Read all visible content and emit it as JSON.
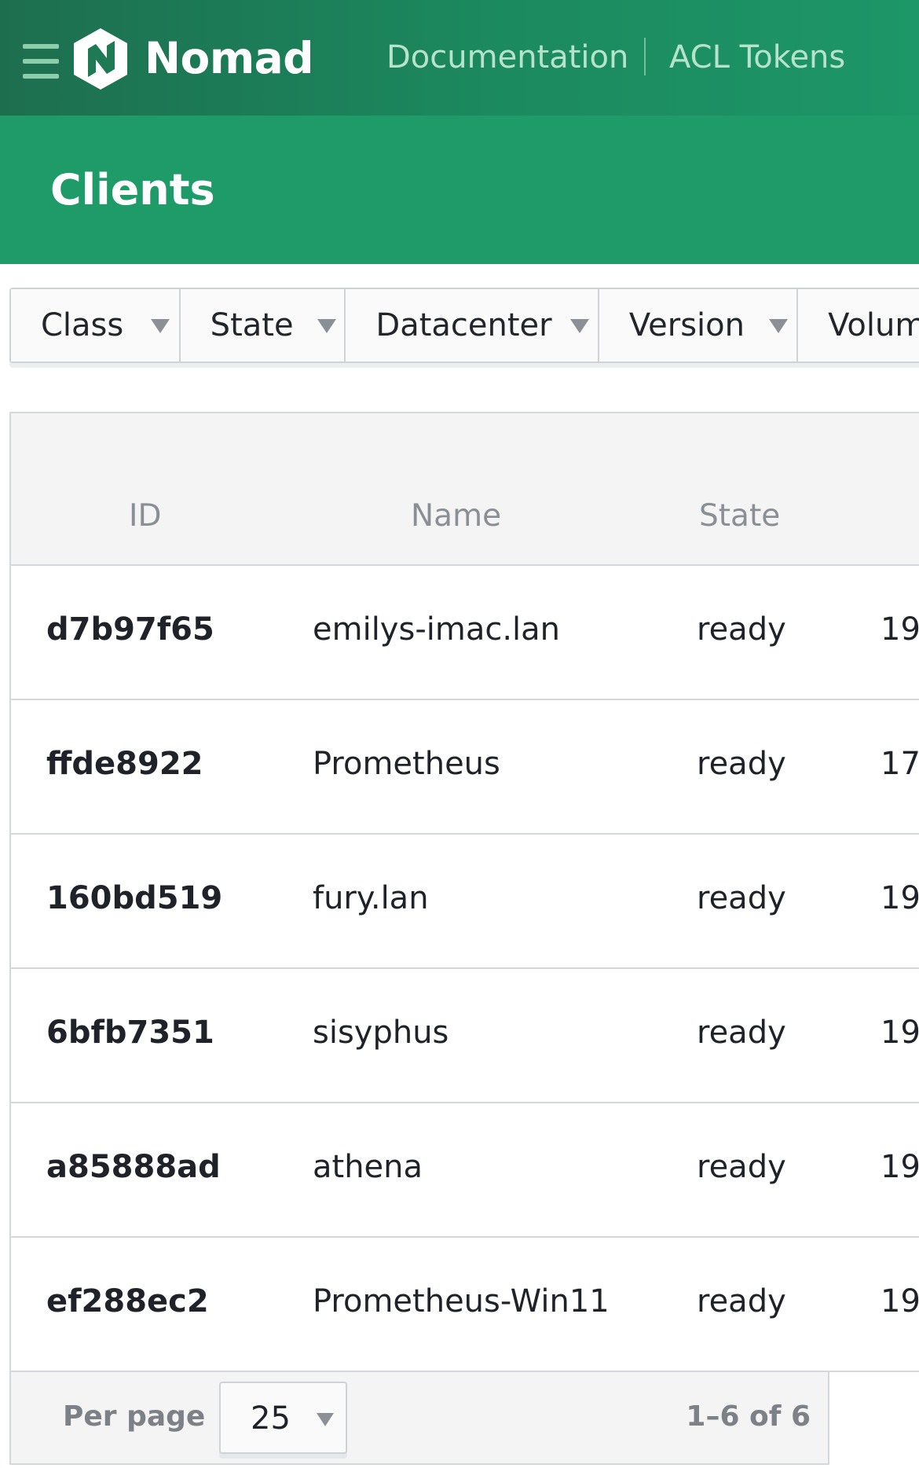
{
  "nav": {
    "brand": "Nomad",
    "links": [
      "Documentation",
      "ACL Tokens"
    ]
  },
  "page": {
    "title": "Clients"
  },
  "filters": [
    "Class",
    "State",
    "Datacenter",
    "Version",
    "Volum"
  ],
  "table": {
    "columns": [
      "ID",
      "Name",
      "State"
    ],
    "rows": [
      {
        "id": "d7b97f65",
        "name": "emilys-imac.lan",
        "state": "ready",
        "address": "19"
      },
      {
        "id": "ffde8922",
        "name": "Prometheus",
        "state": "ready",
        "address": "17"
      },
      {
        "id": "160bd519",
        "name": "fury.lan",
        "state": "ready",
        "address": "19"
      },
      {
        "id": "6bfb7351",
        "name": "sisyphus",
        "state": "ready",
        "address": "19"
      },
      {
        "id": "a85888ad",
        "name": "athena",
        "state": "ready",
        "address": "19"
      },
      {
        "id": "ef288ec2",
        "name": "Prometheus-Win11",
        "state": "ready",
        "address": "19"
      }
    ]
  },
  "pagination": {
    "per_page_label": "Per page",
    "per_page_value": "25",
    "range": "1–6 of 6"
  },
  "colors": {
    "nav_bg": "#1c8a5f",
    "header_bg": "#1f9a69",
    "brand_text": "#ffffff",
    "link_text": "#b7e2cb"
  },
  "icons": {
    "menu": "hamburger-menu-icon",
    "logo": "nomad-logo-icon",
    "dropdown": "caret-down-icon"
  }
}
